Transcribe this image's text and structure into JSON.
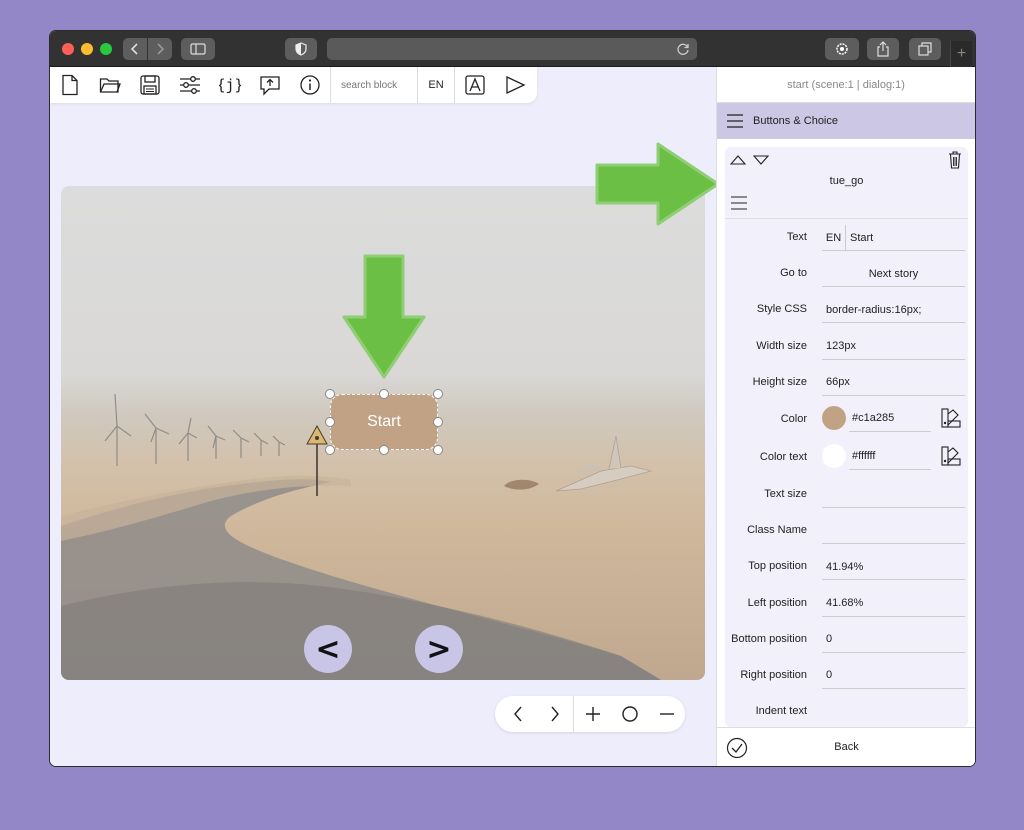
{
  "toolbar": {
    "search_placeholder": "search block",
    "language": "EN"
  },
  "stage": {
    "start_button_label": "Start",
    "start_button_color": "#c1a285",
    "start_button_text_color": "#ffffff",
    "prev_label": "<",
    "next_label": ">"
  },
  "panel": {
    "title": "start (scene:1 | dialog:1)",
    "section": "Buttons & Choice",
    "block_name": "tue_go",
    "props": {
      "text_label": "Text",
      "text_lang": "EN",
      "text_value": "Start",
      "goto_label": "Go to",
      "goto_value": "Next story",
      "style_label": "Style CSS",
      "style_value": "border-radius:16px;",
      "width_label": "Width size",
      "width_value": "123px",
      "height_label": "Height size",
      "height_value": "66px",
      "color_label": "Color",
      "color_value": "#c1a285",
      "color_text_label": "Color text",
      "color_text_value": "#ffffff",
      "text_size_label": "Text size",
      "text_size_value": "",
      "class_label": "Class Name",
      "class_value": "",
      "top_label": "Top position",
      "top_value": "41.94%",
      "left_label": "Left position",
      "left_value": "41.68%",
      "bottom_label": "Bottom position",
      "bottom_value": "0",
      "right_label": "Right position",
      "right_value": "0",
      "indent_label": "Indent text"
    },
    "back_label": "Back"
  },
  "colors": {
    "background": "#9487c8",
    "accent_panel": "#cbc7e4",
    "arrow": "#6cbf45"
  },
  "icons": [
    "file-icon",
    "folder-icon",
    "save-icon",
    "settings-icon",
    "json-icon",
    "upload-icon",
    "info-icon",
    "text-tool-icon",
    "play-icon",
    "hamburger-icon",
    "trash-icon",
    "check-icon",
    "palette-icon"
  ]
}
